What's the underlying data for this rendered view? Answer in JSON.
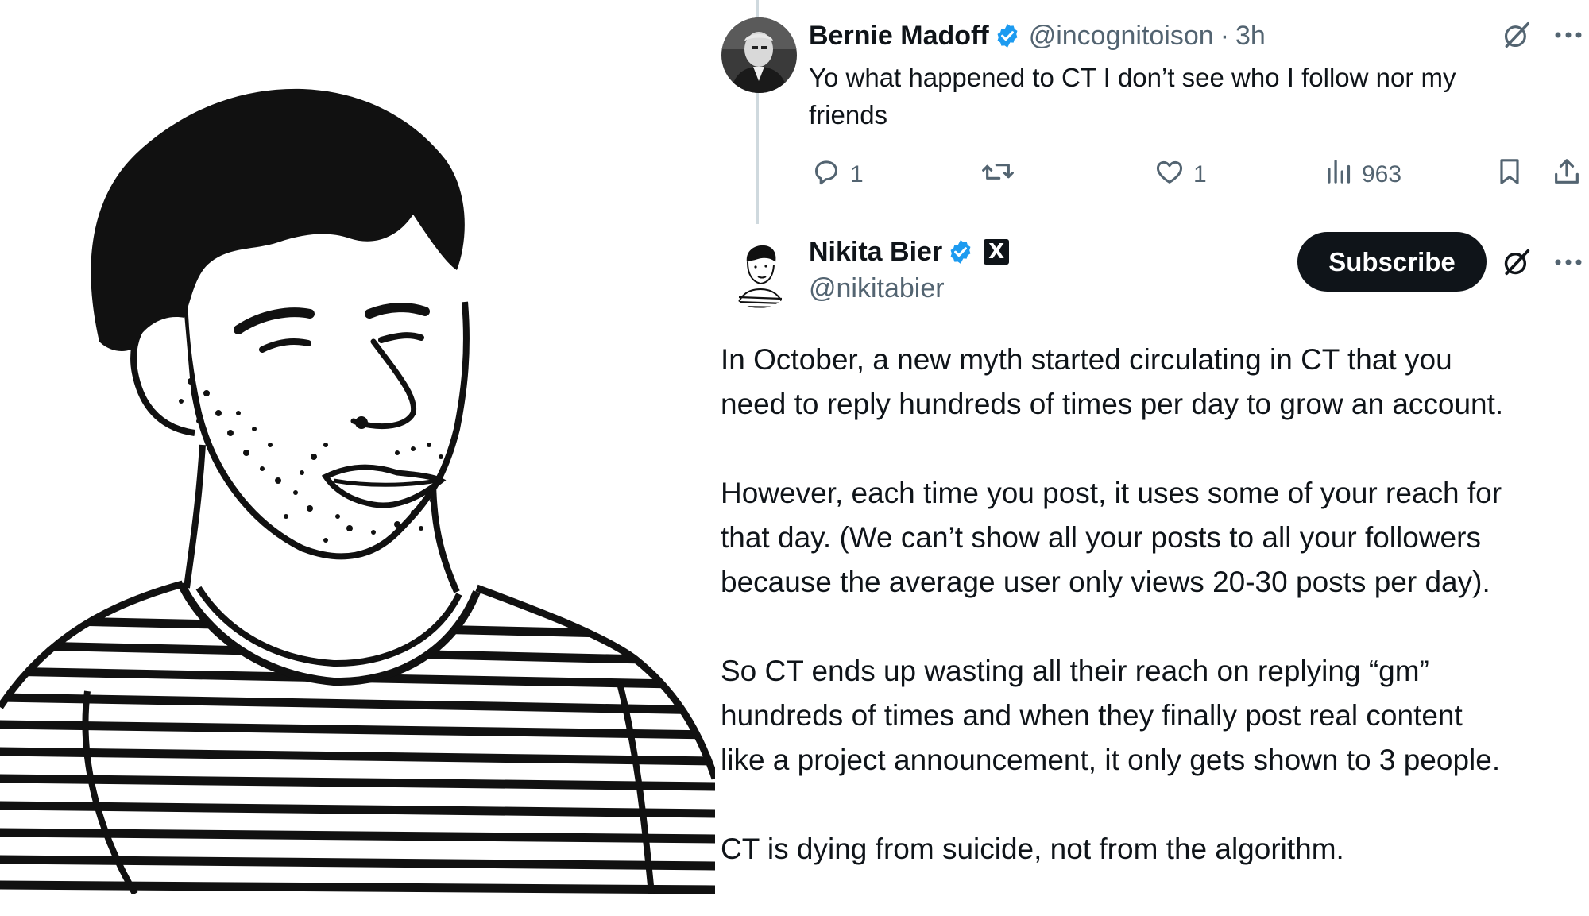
{
  "reply": {
    "author_name": "Bernie Madoff",
    "handle": "@incognitoison",
    "separator": "·",
    "time": "3h",
    "text": "Yo what happened to CT I don’t see who I follow nor my friends",
    "text_lines": [
      "Yo what happened to CT I don’t see who I follow nor my",
      "friends"
    ],
    "actions": {
      "replies": "1",
      "likes": "1",
      "views": "963"
    }
  },
  "post": {
    "author_name": "Nikita Bier",
    "handle": "@nikitabier",
    "affiliate_badge": "X",
    "subscribe_label": "Subscribe",
    "paragraphs": [
      {
        "lines": [
          "In October, a new myth started circulating in CT that you",
          "need to reply hundreds of times per day to grow an account."
        ]
      },
      {
        "lines": [
          "However, each time you post, it uses some of your reach for",
          "that day. (We can’t show all your posts to all your followers",
          "because the average user only views 20-30 posts per day)."
        ]
      },
      {
        "lines": [
          "So CT ends up wasting all their reach on replying “gm”",
          "hundreds of times and when they finally post real content",
          "like a project announcement, it only gets shown to 3 people."
        ]
      },
      {
        "lines": [
          "CT is dying from suicide, not from the algorithm."
        ]
      }
    ]
  },
  "icons": {
    "verified": "verified-badge-icon",
    "grok": "grok-icon",
    "more": "more-icon",
    "reply": "reply-icon",
    "repost": "repost-icon",
    "like": "like-icon",
    "views": "views-icon",
    "bookmark": "bookmark-icon",
    "share": "share-icon"
  },
  "colors": {
    "verified": "#1d9bf0",
    "text": "#0f1419",
    "secondary": "#536471",
    "button": "#0f1419"
  }
}
